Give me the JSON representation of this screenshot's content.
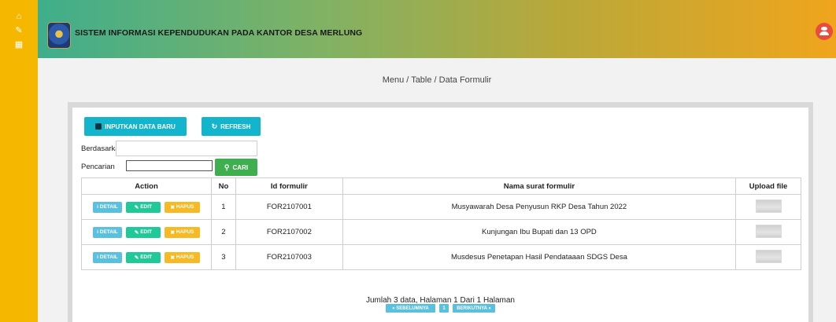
{
  "app": {
    "title": "SISTEM INFORMASI KEPENDUDUKAN PADA KANTOR DESA MERLUNG"
  },
  "sidebar": {
    "icons": [
      "home-icon",
      "edit-icon",
      "calendar-icon"
    ]
  },
  "breadcrumb": "Menu / Table / Data Formulir",
  "toolbar": {
    "add_label": "INPUTKAN DATA BARU",
    "refresh_label": "REFRESH"
  },
  "filter": {
    "berdasarkan_label": "Berdasarkan:",
    "berdasarkan_value": "",
    "pencarian_label": "Pencarian",
    "search_value": "",
    "cari_label": "CARI"
  },
  "table": {
    "headers": [
      "Action",
      "No",
      "Id formulir",
      "Nama surat formulir",
      "Upload file"
    ],
    "action_labels": {
      "detail": "DETAIL",
      "edit": "EDIT",
      "hapus": "HAPUS"
    },
    "rows": [
      {
        "no": "1",
        "id": "FOR2107001",
        "nama": "Musyawarah Desa Penyusun RKP Desa Tahun 2022"
      },
      {
        "no": "2",
        "id": "FOR2107002",
        "nama": "Kunjungan Ibu Bupati dan 13 OPD"
      },
      {
        "no": "3",
        "id": "FOR2107003",
        "nama": "Musdesus Penetapan Hasil Pendataaan SDGS Desa"
      }
    ]
  },
  "footer": {
    "info": "Jumlah 3 data, Halaman 1 Dari 1 Halaman",
    "prev_label": "« SEBELUMNYA",
    "page_label": "1",
    "next_label": "BERIKUTNYA »"
  },
  "colors": {
    "sidebar": "#f5b700",
    "primary_button": "#12b5cb",
    "search_button": "#3fae4f",
    "detail_button": "#5bc0de",
    "edit_button": "#20c997",
    "hapus_button": "#f7b924",
    "avatar": "#e74c3c"
  }
}
